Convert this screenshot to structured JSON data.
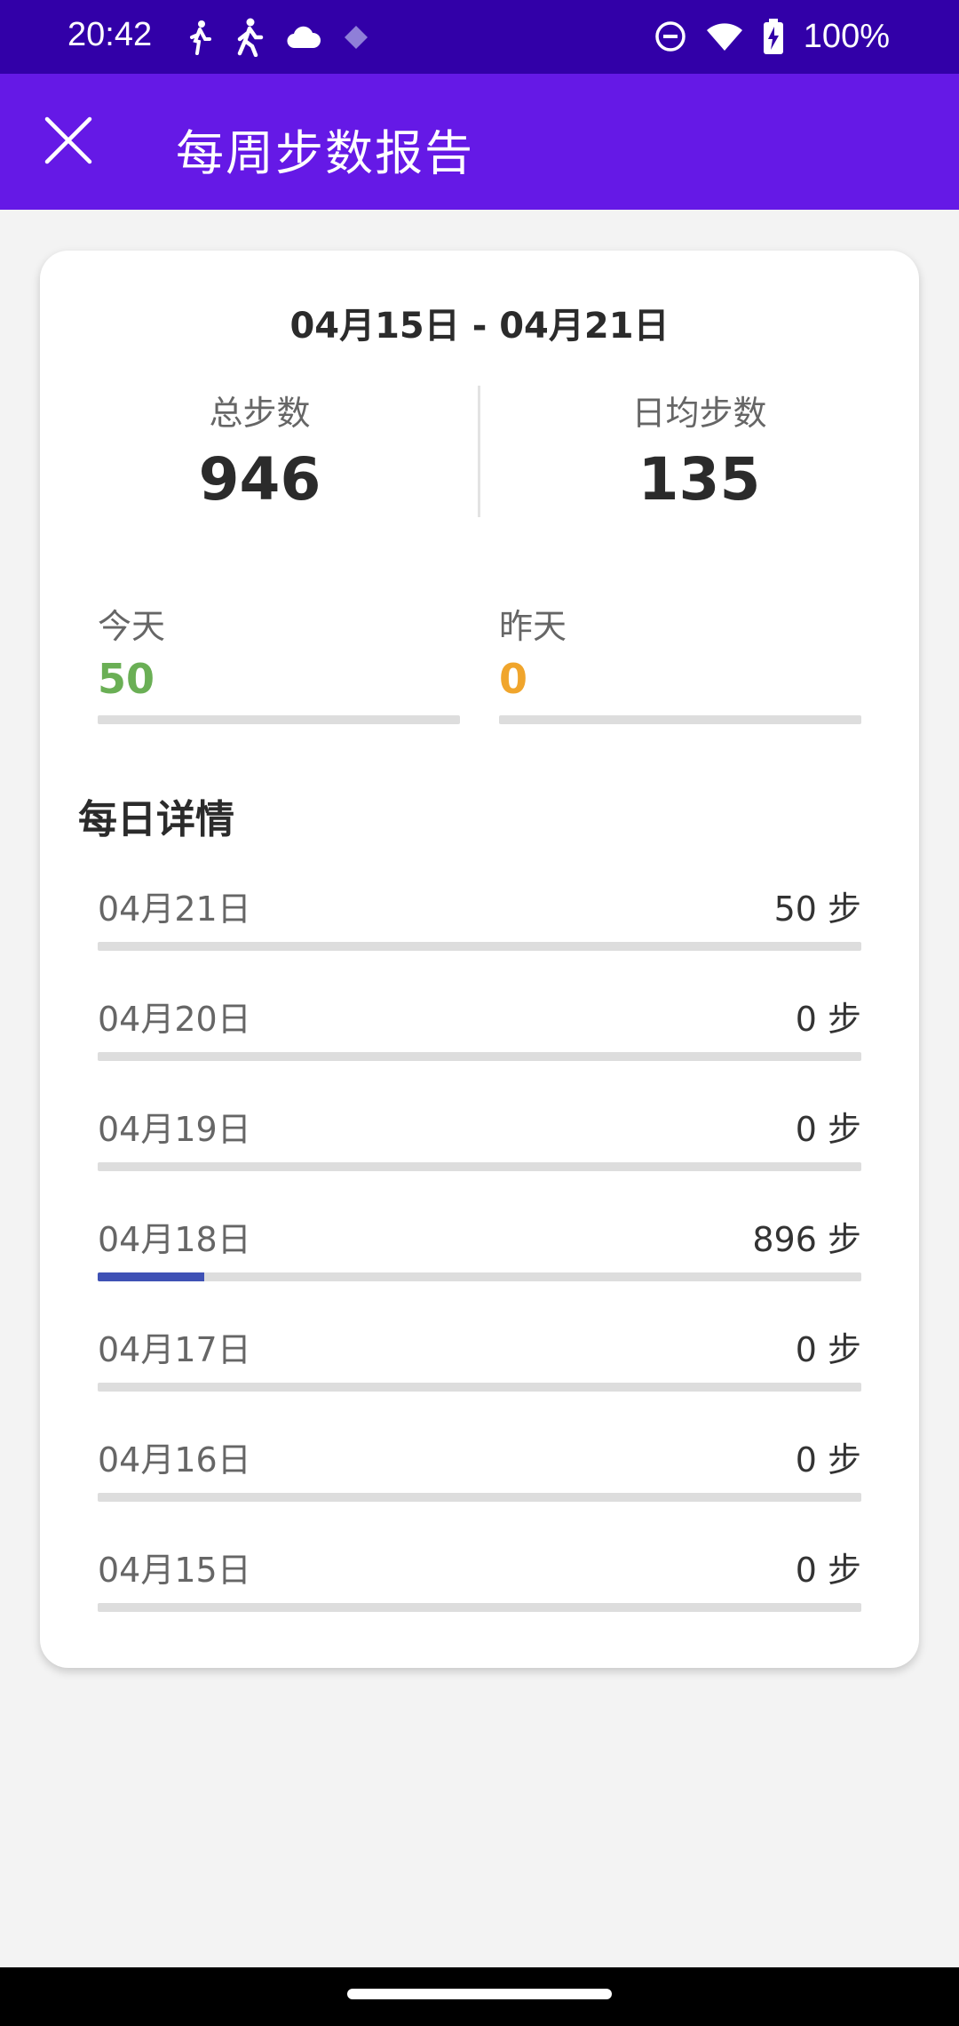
{
  "status_bar": {
    "time": "20:42",
    "battery": "100%",
    "icons_left": [
      "walk-icon",
      "hike-icon",
      "cloud-icon",
      "diamond-icon"
    ],
    "icons_right": [
      "dnd-icon",
      "wifi-icon",
      "battery-charging-icon"
    ]
  },
  "app_bar": {
    "title": "每周步数报告",
    "close_icon": "close-icon"
  },
  "report": {
    "date_range": "04月15日 - 04月21日",
    "total_label": "总步数",
    "total_value": "946",
    "average_label": "日均步数",
    "average_value": "135",
    "today_label": "今天",
    "today_value": "50",
    "today_progress": 0.0,
    "yesterday_label": "昨天",
    "yesterday_value": "0",
    "yesterday_progress": 0.0,
    "section_title": "每日详情",
    "days": [
      {
        "date": "04月21日",
        "steps": "50 步",
        "progress": 0.0
      },
      {
        "date": "04月20日",
        "steps": "0 步",
        "progress": 0.0
      },
      {
        "date": "04月19日",
        "steps": "0 步",
        "progress": 0.0
      },
      {
        "date": "04月18日",
        "steps": "896 步",
        "progress": 0.14
      },
      {
        "date": "04月17日",
        "steps": "0 步",
        "progress": 0.0
      },
      {
        "date": "04月16日",
        "steps": "0 步",
        "progress": 0.0
      },
      {
        "date": "04月15日",
        "steps": "0 步",
        "progress": 0.0
      }
    ]
  },
  "colors": {
    "status_bar": "#3200a8",
    "app_bar": "#6519e6",
    "today": "#6aaf55",
    "yesterday": "#f0a52c",
    "progress_fill": "#3f51b5",
    "progress_track": "#dddddd"
  }
}
